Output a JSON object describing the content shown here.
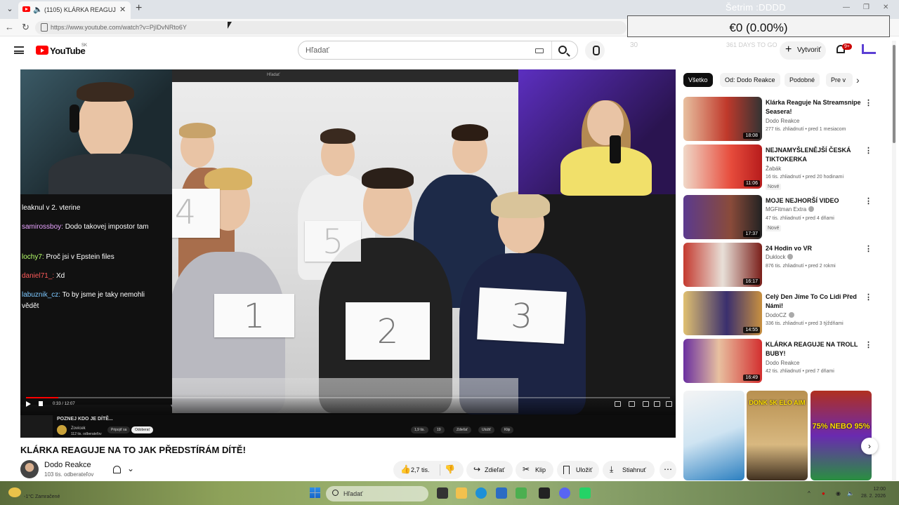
{
  "browser": {
    "tab_title": "(1105) KLÁRKA REAGUJE NA T",
    "url": "https://www.youtube.com/watch?v=PjIDvNRto6Y",
    "window_title": "Šetrim :DDDD",
    "overlay_value": "€0 (0.00%)",
    "overlay_sub": "361 DAYS TO GO",
    "overlay_corner": "30"
  },
  "youtube": {
    "logo_text": "YouTube",
    "country": "SK",
    "search_placeholder": "Hľadať",
    "create_label": "Vytvoriť",
    "notif_badge": "9+"
  },
  "video": {
    "title": "KLÁRKA REAGUJE NA TO JAK PŘEDSTÍRÁM DÍTĚ!",
    "progress": 0.05,
    "time": "0:33 / 12:07",
    "inner_header": "Hľadať",
    "inner_title": "POZNEJ KDO JE DÍTĚ...",
    "inner_channel": "Zovicek",
    "inner_subs": "112 tis. odberateľov",
    "inner_join": "Pripojiť sa",
    "inner_subscribe": "Odoberať",
    "inner_likes": "1,9 tis.",
    "inner_dislikes": "19",
    "inner_share": "Zdieľať",
    "inner_save": "Uložiť",
    "inner_clip": "Klip",
    "cards": [
      "1",
      "2",
      "3",
      "4",
      "5"
    ],
    "chat": [
      {
        "user": "",
        "text": "leaknul v 2. vterine"
      },
      {
        "user": "samirossboy:",
        "text": "Dodo takovej impostor tam"
      },
      {
        "user": "lochy7:",
        "text": "Proč jsi v Epstein files"
      },
      {
        "user": "daniel71_:",
        "text": "Xd"
      },
      {
        "user": "labuznik_cz:",
        "text": "To by jsme je taky nemohli vědět"
      }
    ]
  },
  "channel": {
    "name": "Dodo Reakce",
    "subs": "103 tis. odberateľov"
  },
  "actions": {
    "likes": "2,7 tis.",
    "share": "Zdieľať",
    "clip": "Klip",
    "save": "Uložiť",
    "download": "Stiahnuť"
  },
  "chips": [
    "Všetko",
    "Od: Dodo Reakce",
    "Podobné",
    "Pre v"
  ],
  "recommendations": [
    {
      "title": "Klárka Reaguje Na Streamsnipe Seasera!",
      "channel": "Dodo Reakce",
      "meta": "277 tis. zhliadnutí • pred 1 mesiacom",
      "duration": "18:08",
      "badge": "",
      "verified": false
    },
    {
      "title": "NEJNAMYŠLENĚJŠÍ ČESKÁ TIKTOKERKA",
      "channel": "Žabák",
      "meta": "16 tis. zhliadnutí • pred 20 hodinami",
      "duration": "11:06",
      "badge": "Nové",
      "verified": false
    },
    {
      "title": "MOJE NEJHORŠÍ VIDEO",
      "channel": "MGFitman Extra",
      "meta": "47 tis. zhliadnutí • pred 4 dňami",
      "duration": "17:37",
      "badge": "Nové",
      "verified": true
    },
    {
      "title": "24 Hodin vo VR",
      "channel": "Duklock",
      "meta": "876 tis. zhliadnutí • pred 2 rokmi",
      "duration": "16:17",
      "badge": "",
      "verified": true
    },
    {
      "title": "Celý Den Jíme To Co Lidi Před Námi!",
      "channel": "DodoCZ",
      "meta": "336 tis. zhliadnutí • pred 3 týždňami",
      "duration": "14:55",
      "badge": "",
      "verified": true
    },
    {
      "title": "KLÁRKA REAGUJE NA TROLL BUBY!",
      "channel": "Dodo Reakce",
      "meta": "42 tis. zhliadnutí • pred 7 dňami",
      "duration": "16:49",
      "badge": "",
      "verified": false
    }
  ],
  "shorts": [
    {
      "caption": ""
    },
    {
      "caption": "DONK 5K ELO AIM"
    },
    {
      "caption": "75% NEBO 95%"
    }
  ],
  "taskbar": {
    "search_label": "Hľadať",
    "weather": "-1°C Zamračené",
    "clock_time": "12:00",
    "clock_date": "28. 2. 2026"
  },
  "colors": {
    "yt_red": "#ff0000",
    "chip_active": "#0f0f0f",
    "notif_red": "#cc0000"
  }
}
